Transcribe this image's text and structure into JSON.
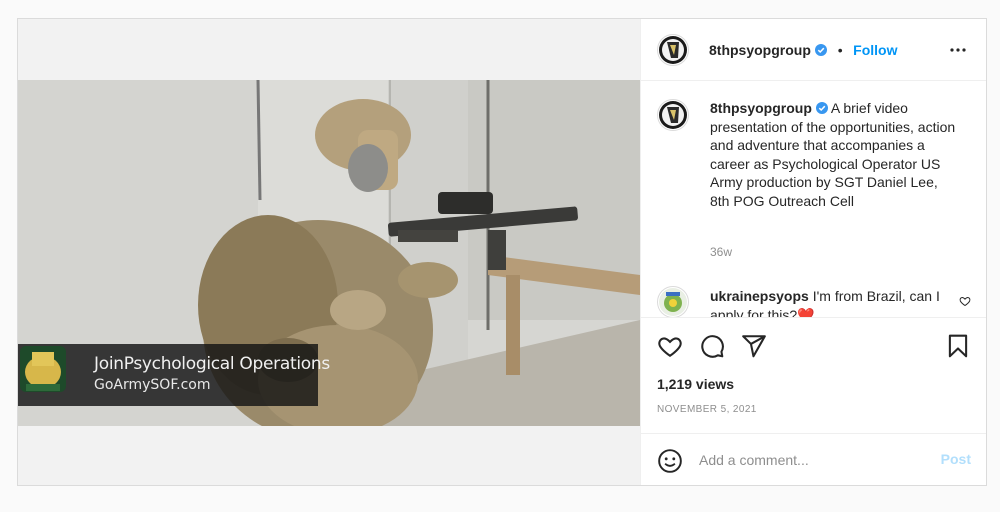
{
  "post": {
    "account": {
      "username": "8thpsyopgroup",
      "verified": true,
      "follow_label": "Follow",
      "separator": "•"
    },
    "media": {
      "overlay_title": "JoinPsychological Operations",
      "overlay_url": "GoArmySOF.com"
    },
    "caption": {
      "username": "8thpsyopgroup",
      "text": "A brief video presentation of the opportunities, action and adventure that accompanies a career as Psychological Operator US Army production by SGT Daniel Lee, 8th POG Outreach Cell",
      "age": "36w"
    },
    "comments": [
      {
        "username": "ukrainepsyops",
        "text": "I'm from Brazil, can I apply for this?❤️"
      }
    ],
    "stats": {
      "views": "1,219 views",
      "date": "NOVEMBER 5, 2021"
    },
    "add_comment": {
      "placeholder": "Add a comment...",
      "post_label": "Post"
    },
    "icons": {
      "like": "heart-icon",
      "comment": "comment-icon",
      "share": "share-icon",
      "save": "bookmark-icon",
      "more": "more-options-icon",
      "emoji": "emoji-icon"
    },
    "colors": {
      "accent": "#0095f6",
      "post_disabled": "#b2dffc",
      "secondary_text": "#8e8e8e"
    }
  }
}
